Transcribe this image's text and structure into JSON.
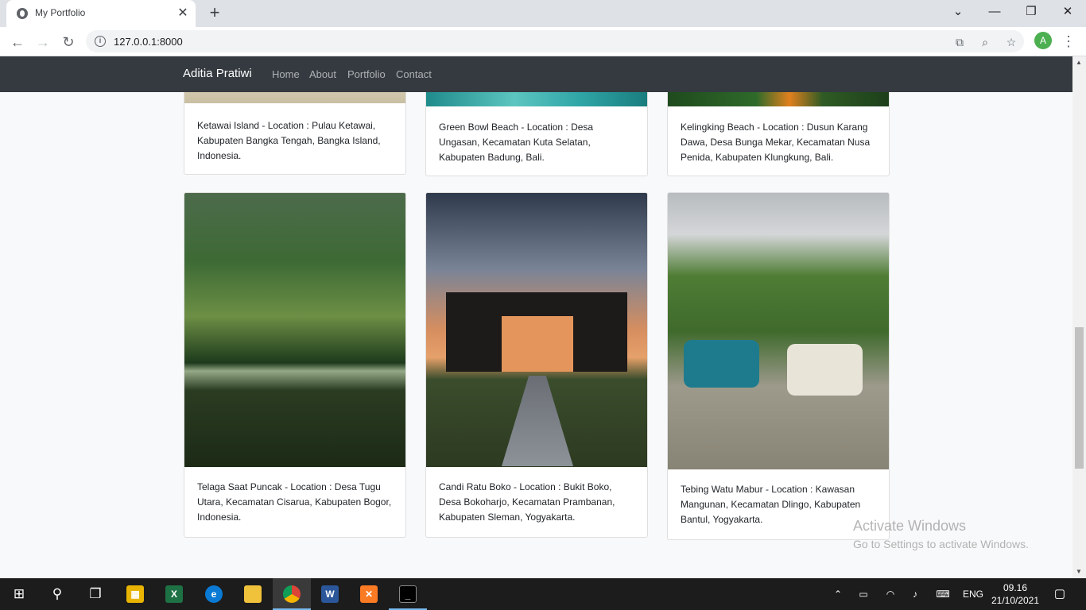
{
  "browser": {
    "tab_title": "My Portfolio",
    "url": "127.0.0.1:8000",
    "profile_initial": "A"
  },
  "navbar": {
    "brand": "Aditia Pratiwi",
    "links": [
      "Home",
      "About",
      "Portfolio",
      "Contact"
    ]
  },
  "cards": [
    {
      "text": "Ketawai Island - Location : Pulau Ketawai, Kabupaten Bangka Tengah, Bangka Island, Indonesia."
    },
    {
      "text": "Green Bowl Beach - Location : Desa Ungasan, Kecamatan Kuta Selatan, Kabupaten Badung, Bali."
    },
    {
      "text": "Kelingking Beach - Location : Dusun Karang Dawa, Desa Bunga Mekar, Kecamatan Nusa Penida, Kabupaten Klungkung, Bali."
    },
    {
      "text": "Telaga Saat Puncak - Location : Desa Tugu Utara, Kecamatan Cisarua, Kabupaten Bogor, Indonesia."
    },
    {
      "text": "Candi Ratu Boko - Location : Bukit Boko, Desa Bokoharjo, Kecamatan Prambanan, Kabupaten Sleman, Yogyakarta."
    },
    {
      "text": "Tebing Watu Mabur - Location : Kawasan Mangunan, Kecamatan Dlingo, Kabupaten Bantul, Yogyakarta."
    }
  ],
  "watermark": {
    "line1": "Activate Windows",
    "line2": "Go to Settings to activate Windows."
  },
  "taskbar": {
    "language": "ENG",
    "time": "09.16",
    "date": "21/10/2021"
  }
}
